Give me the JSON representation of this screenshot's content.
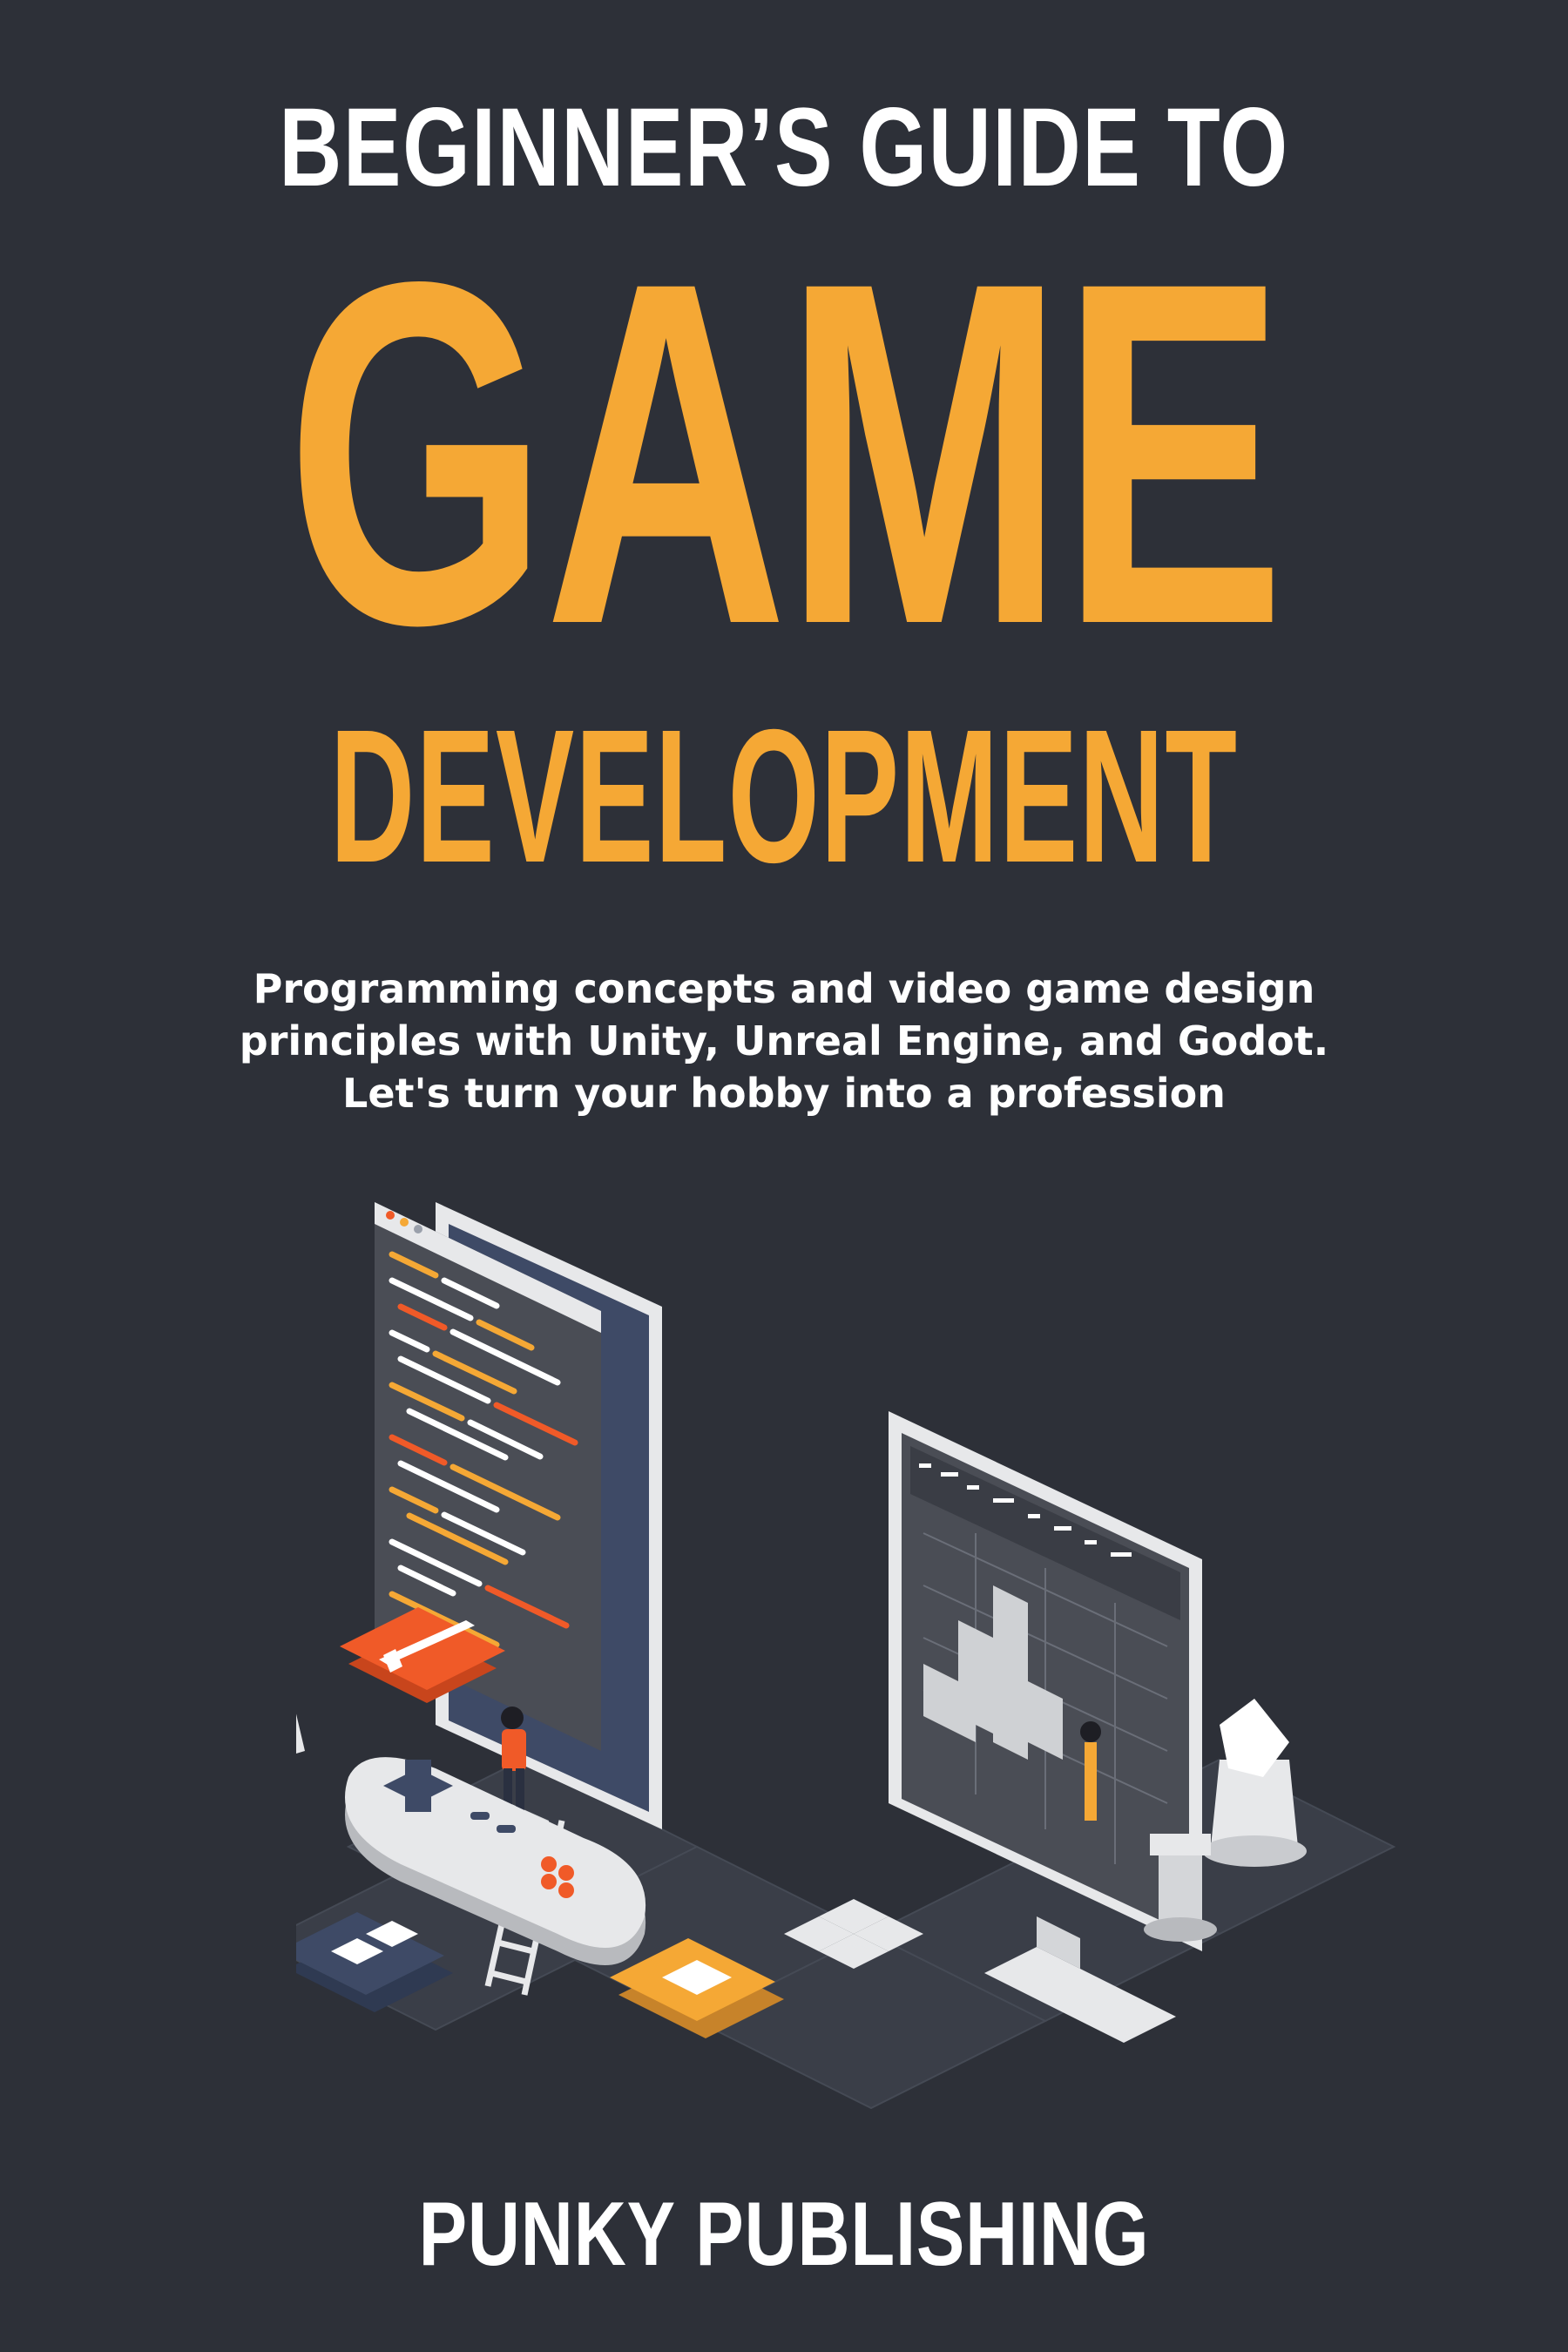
{
  "cover": {
    "title_line1": "BEGINNER’S GUIDE TO",
    "title_line2": "GAME",
    "title_line3": "DEVELOPMENT",
    "subtitle_lines": [
      "Programming concepts and video game design",
      "principles with Unity, Unreal Engine, and Godot.",
      "Let's turn your hobby into a profession"
    ],
    "publisher": "PUNKY PUBLISHING"
  },
  "colors": {
    "background": "#2d3038",
    "accent": "#f5a835",
    "text": "#ffffff",
    "orange_red": "#f05a28",
    "panel_gray": "#e7e8ea",
    "dark_navy": "#3e4a66"
  },
  "illustration": {
    "icons": [
      "code-editor-monitor-icon",
      "3d-editor-monitor-icon",
      "gamepad-icon",
      "sword-tile-icon",
      "dice-tile-icon",
      "puzzle-tile-icon",
      "star-card-icon",
      "chess-knight-icon",
      "chess-rook-icon",
      "arrow-keys-icon",
      "ladder-icon",
      "person-figure-icon"
    ]
  }
}
